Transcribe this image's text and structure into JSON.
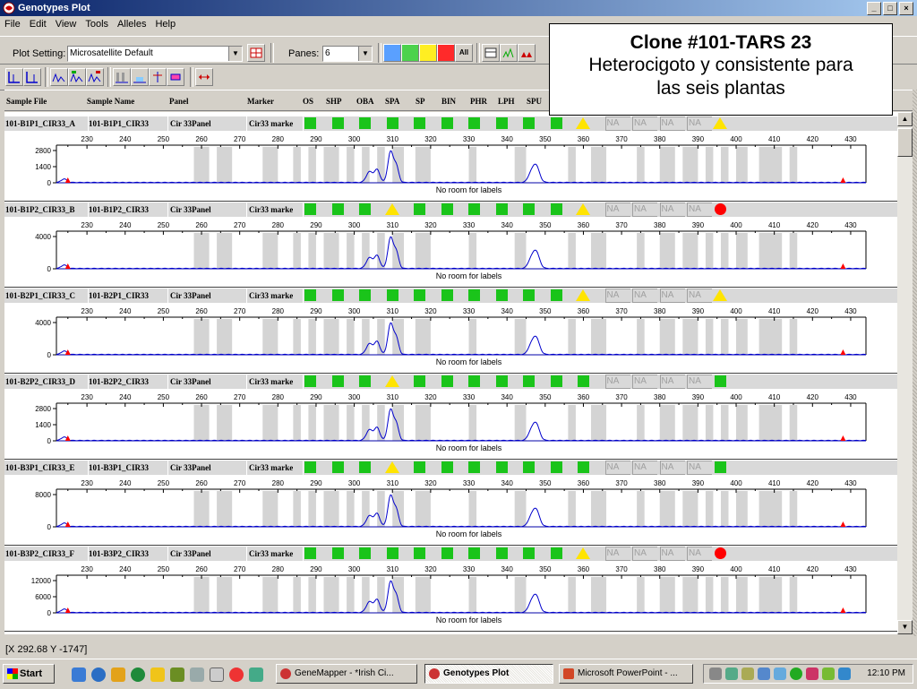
{
  "window": {
    "title": "Genotypes Plot",
    "icon": "genemapper-icon"
  },
  "menu": [
    "File",
    "Edit",
    "View",
    "Tools",
    "Alleles",
    "Help"
  ],
  "toolbar": {
    "plot_setting_label": "Plot Setting:",
    "plot_setting_value": "Microsatellite Default",
    "panes_label": "Panes:",
    "panes_value": "6"
  },
  "columns": [
    "Sample File",
    "Sample Name",
    "Panel",
    "Marker",
    "OS",
    "SHP",
    "OBA",
    "SPA",
    "SP",
    "BIN",
    "PHR",
    "LPH",
    "SPU"
  ],
  "overlay": {
    "line1": "Clone #101-TARS 23",
    "line2": "Heterocigoto y consistente para",
    "line3": "las seis plantas"
  },
  "x_ticks": [
    230,
    240,
    250,
    260,
    270,
    280,
    290,
    300,
    310,
    320,
    330,
    340,
    350,
    360,
    370,
    380,
    390,
    400,
    410,
    420,
    430
  ],
  "no_room_label": "No room for labels",
  "na_label": "NA",
  "samples": [
    {
      "file": "101-B1P1_CIR33_A",
      "name": "101-B1P1_CIR33",
      "panel": "Cir 33Panel",
      "marker": "Cir33 marke",
      "quality": [
        "green",
        "green",
        "green",
        "green",
        "green",
        "green",
        "green",
        "green",
        "green",
        "green",
        "yellow",
        "na",
        "na",
        "na",
        "na",
        "yellow"
      ],
      "y_ticks": [
        "2800",
        "1400",
        "0"
      ]
    },
    {
      "file": "101-B1P2_CIR33_B",
      "name": "101-B1P2_CIR33",
      "panel": "Cir 33Panel",
      "marker": "Cir33 marke",
      "quality": [
        "green",
        "green",
        "green",
        "yellow",
        "green",
        "green",
        "green",
        "green",
        "green",
        "green",
        "yellow",
        "na",
        "na",
        "na",
        "na",
        "red"
      ],
      "y_ticks": [
        "4000",
        "0"
      ]
    },
    {
      "file": "101-B2P1_CIR33_C",
      "name": "101-B2P1_CIR33",
      "panel": "Cir 33Panel",
      "marker": "Cir33 marke",
      "quality": [
        "green",
        "green",
        "green",
        "green",
        "green",
        "green",
        "green",
        "green",
        "green",
        "green",
        "yellow",
        "na",
        "na",
        "na",
        "na",
        "yellow"
      ],
      "y_ticks": [
        "4000",
        "0"
      ]
    },
    {
      "file": "101-B2P2_CIR33_D",
      "name": "101-B2P2_CIR33",
      "panel": "Cir 33Panel",
      "marker": "Cir33 marke",
      "quality": [
        "green",
        "green",
        "green",
        "yellow",
        "green",
        "green",
        "green",
        "green",
        "green",
        "green",
        "green",
        "na",
        "na",
        "na",
        "na",
        "green"
      ],
      "y_ticks": [
        "2800",
        "1400",
        "0"
      ]
    },
    {
      "file": "101-B3P1_CIR33_E",
      "name": "101-B3P1_CIR33",
      "panel": "Cir 33Panel",
      "marker": "Cir33 marke",
      "quality": [
        "green",
        "green",
        "green",
        "yellow",
        "green",
        "green",
        "green",
        "green",
        "green",
        "green",
        "green",
        "na",
        "na",
        "na",
        "na",
        "green"
      ],
      "y_ticks": [
        "8000",
        "0"
      ]
    },
    {
      "file": "101-B3P2_CIR33_F",
      "name": "101-B3P2_CIR33",
      "panel": "Cir 33Panel",
      "marker": "Cir33 marke",
      "quality": [
        "green",
        "green",
        "green",
        "green",
        "green",
        "green",
        "green",
        "green",
        "green",
        "green",
        "yellow",
        "na",
        "na",
        "na",
        "na",
        "red"
      ],
      "y_ticks": [
        "12000",
        "6000",
        "0"
      ]
    }
  ],
  "status": {
    "coords": "[X 292.68  Y -1747]"
  },
  "taskbar": {
    "start": "Start",
    "tasks": [
      "GeneMapper - *Irish  Ci...",
      "Genotypes Plot",
      "Microsoft PowerPoint - ..."
    ],
    "clock": "12:10 PM"
  },
  "colors": {
    "bin_gray": "#d4d4d4",
    "trace_blue": "#0000cc",
    "green": "#1ac41a",
    "yellow": "#ffe400",
    "red": "#ff0000"
  }
}
